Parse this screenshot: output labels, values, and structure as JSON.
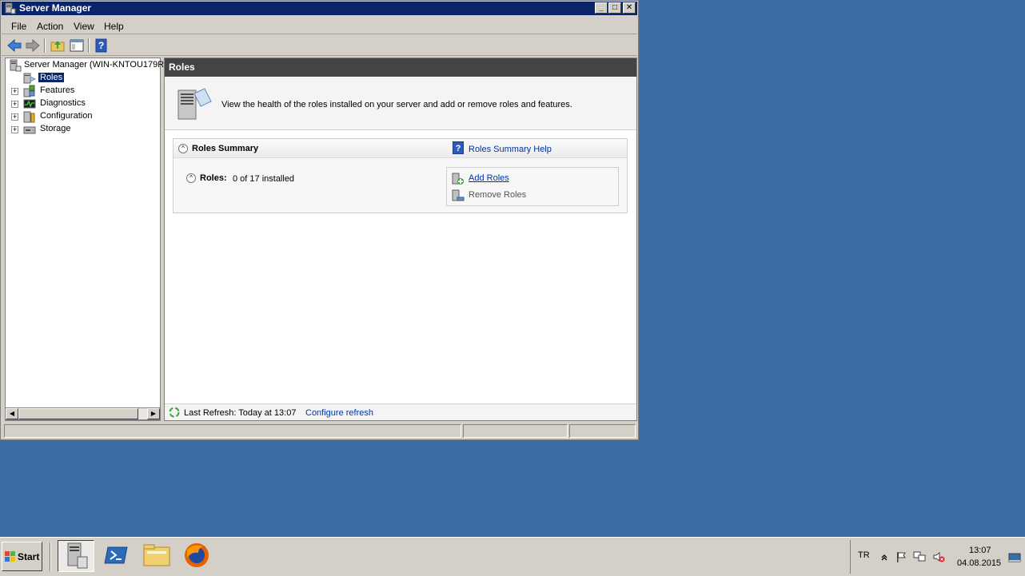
{
  "window": {
    "title": "Server Manager",
    "controls": {
      "minimize": "_",
      "maximize": "□",
      "close": "✕"
    }
  },
  "menu": {
    "file": "File",
    "action": "Action",
    "view": "View",
    "help": "Help"
  },
  "toolbar": {
    "back_icon": "arrow-left-icon",
    "forward_icon": "arrow-right-icon",
    "up_icon": "folder-up-icon",
    "show_hide_icon": "console-tree-icon",
    "help_icon": "help-icon"
  },
  "tree": {
    "root": "Server Manager (WIN-KNTOU179R",
    "items": [
      {
        "label": "Roles",
        "expander": "",
        "selected": true
      },
      {
        "label": "Features",
        "expander": "+"
      },
      {
        "label": "Diagnostics",
        "expander": "+"
      },
      {
        "label": "Configuration",
        "expander": "+"
      },
      {
        "label": "Storage",
        "expander": "+"
      }
    ]
  },
  "content": {
    "header": "Roles",
    "intro": "View the health of the roles installed on your server and add or remove roles and features.",
    "summary": {
      "title": "Roles Summary",
      "help_icon_text": "?",
      "help_link": "Roles Summary Help",
      "roles_label": "Roles:",
      "roles_count": "0 of 17 installed",
      "add_roles": "Add Roles",
      "remove_roles": "Remove Roles"
    },
    "refresh": {
      "text": "Last Refresh: Today at 13:07",
      "link": "Configure refresh"
    }
  },
  "taskbar": {
    "start_label": "Start",
    "language": "TR",
    "time": "13:07",
    "date": "04.08.2015"
  },
  "colors": {
    "desktop": "#3a6ea5",
    "titlebar": "#0a246a",
    "link": "#0033aa",
    "panel_header": "#444444"
  }
}
